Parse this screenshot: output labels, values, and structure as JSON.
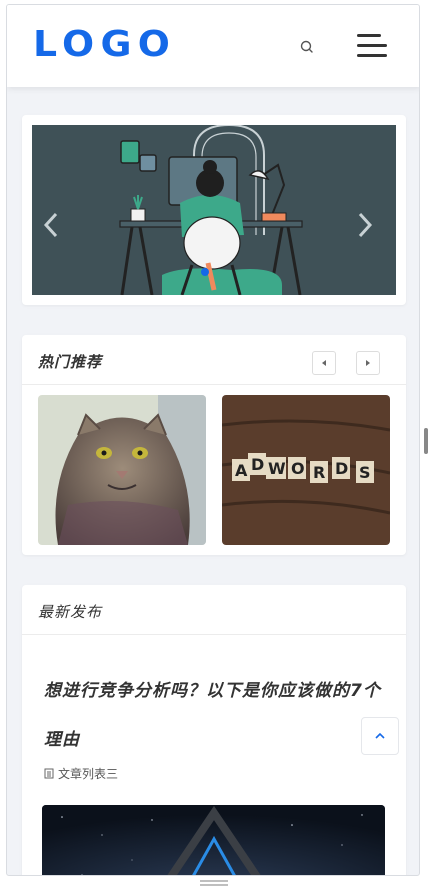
{
  "header": {
    "logo_text": "LOGO",
    "search_icon": "search-icon",
    "menu_icon": "hamburger-menu-icon"
  },
  "banner": {
    "prev_icon": "chevron-left-icon",
    "next_icon": "chevron-right-icon"
  },
  "hot": {
    "title": "热门推荐",
    "prev_icon": "caret-left-icon",
    "next_icon": "caret-right-icon",
    "items": [
      {
        "image": "cat-photo"
      },
      {
        "image": "adwords-tiles-photo",
        "tile_text": "ADWORDS"
      }
    ]
  },
  "latest": {
    "title": "最新发布",
    "article": {
      "title": "想进行竞争分析吗？以下是你应该做的7个理由",
      "category": "文章列表三",
      "category_icon": "document-icon"
    }
  },
  "back_to_top_icon": "chevron-up-icon",
  "colors": {
    "accent": "#1569e8",
    "banner_bg": "#3f5157",
    "page_bg": "#f1f3f7"
  }
}
